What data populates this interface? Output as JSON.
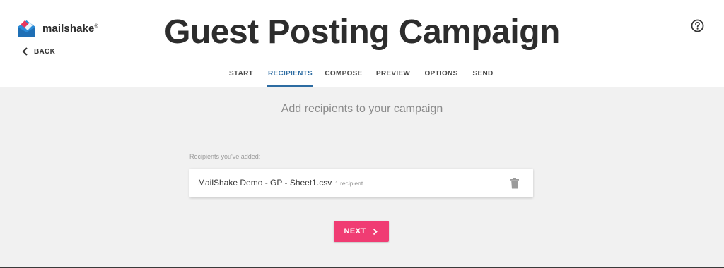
{
  "app": {
    "logo_text": "mailshake",
    "logo_trademark": "®"
  },
  "header": {
    "back_label": "BACK",
    "page_title": "Guest Posting Campaign"
  },
  "tabs": [
    {
      "label": "START",
      "active": false
    },
    {
      "label": "RECIPIENTS",
      "active": true
    },
    {
      "label": "COMPOSE",
      "active": false
    },
    {
      "label": "PREVIEW",
      "active": false
    },
    {
      "label": "OPTIONS",
      "active": false
    },
    {
      "label": "SEND",
      "active": false
    }
  ],
  "main": {
    "subtitle": "Add recipients to your campaign",
    "recipients_label": "Recipients you've added:",
    "recipients": [
      {
        "file_name": "MailShake Demo - GP - Sheet1.csv",
        "count": "1 recipient"
      }
    ],
    "next_label": "NEXT"
  },
  "colors": {
    "accent": "#2d6ca2",
    "primary_button": "#f03c73",
    "background": "#f1f1f1"
  },
  "icons": [
    "mailshake-logo-icon",
    "chevron-left-icon",
    "help-circle-icon",
    "trash-icon",
    "chevron-right-icon"
  ]
}
